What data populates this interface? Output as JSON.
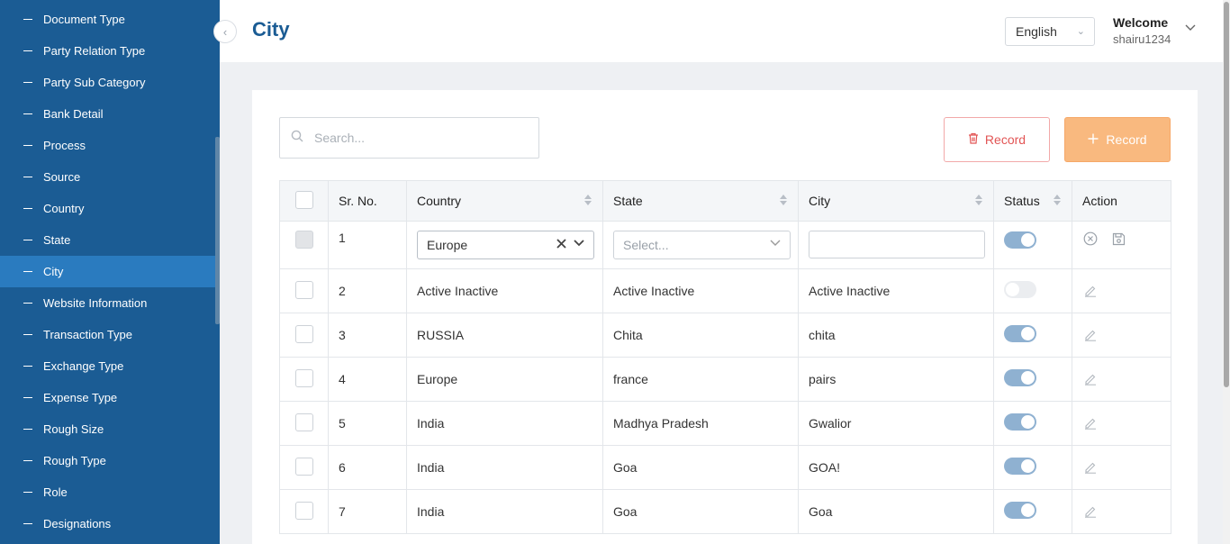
{
  "sidebar": {
    "items": [
      {
        "label": "Document Type",
        "active": false
      },
      {
        "label": "Party Relation Type",
        "active": false
      },
      {
        "label": "Party Sub Category",
        "active": false
      },
      {
        "label": "Bank Detail",
        "active": false
      },
      {
        "label": "Process",
        "active": false
      },
      {
        "label": "Source",
        "active": false
      },
      {
        "label": "Country",
        "active": false
      },
      {
        "label": "State",
        "active": false
      },
      {
        "label": "City",
        "active": true
      },
      {
        "label": "Website Information",
        "active": false
      },
      {
        "label": "Transaction Type",
        "active": false
      },
      {
        "label": "Exchange Type",
        "active": false
      },
      {
        "label": "Expense Type",
        "active": false
      },
      {
        "label": "Rough Size",
        "active": false
      },
      {
        "label": "Rough Type",
        "active": false
      },
      {
        "label": "Role",
        "active": false
      },
      {
        "label": "Designations",
        "active": false
      }
    ]
  },
  "header": {
    "title": "City",
    "language": "English",
    "welcome": "Welcome",
    "username": "shairu1234"
  },
  "toolbar": {
    "search_placeholder": "Search...",
    "delete_label": "Record",
    "add_label": "Record"
  },
  "table": {
    "columns": [
      "Sr. No.",
      "Country",
      "State",
      "City",
      "Status",
      "Action"
    ],
    "edit_row": {
      "sr": "1",
      "country": "Europe",
      "state_placeholder": "Select...",
      "city": "",
      "status": true
    },
    "rows": [
      {
        "sr": "2",
        "country": "Active Inactive",
        "state": "Active Inactive",
        "city": "Active Inactive",
        "status": false
      },
      {
        "sr": "3",
        "country": "RUSSIA",
        "state": "Chita",
        "city": "chita",
        "status": true
      },
      {
        "sr": "4",
        "country": "Europe",
        "state": "france",
        "city": "pairs",
        "status": true
      },
      {
        "sr": "5",
        "country": "India",
        "state": "Madhya Pradesh",
        "city": "Gwalior",
        "status": true
      },
      {
        "sr": "6",
        "country": "India",
        "state": "Goa",
        "city": "GOA!",
        "status": true
      },
      {
        "sr": "7",
        "country": "India",
        "state": "Goa",
        "city": "Goa",
        "status": true
      }
    ]
  },
  "colors": {
    "sidebar_bg": "#1b5c94",
    "sidebar_active": "#2a7bbf",
    "title": "#1b5c94",
    "add_button": "#f9b97f",
    "delete_border": "#f2a9a9",
    "toggle_on": "#8fb1d1"
  }
}
